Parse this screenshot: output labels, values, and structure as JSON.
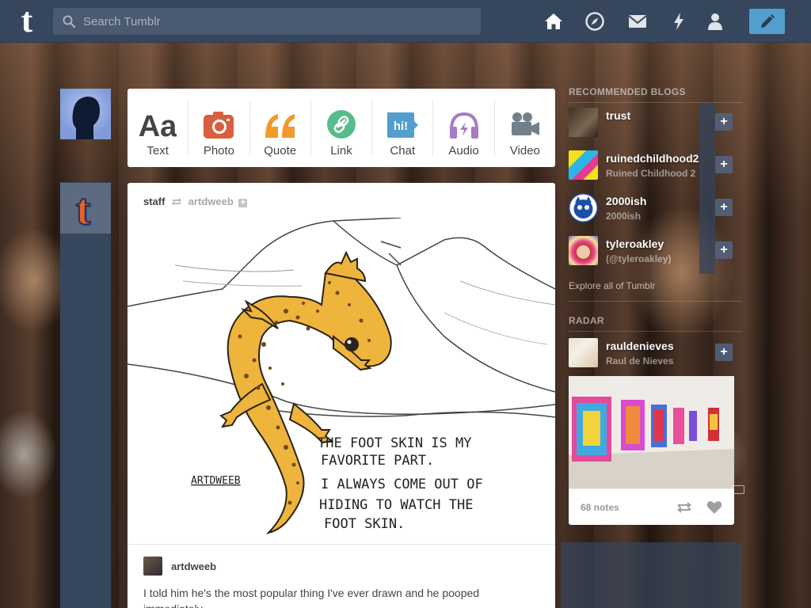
{
  "header": {
    "logo": "t",
    "search_placeholder": "Search Tumblr",
    "nav": [
      "home-icon",
      "explore-icon",
      "inbox-icon",
      "activity-icon",
      "account-icon"
    ],
    "compose_icon": "pencil-icon"
  },
  "post_types": [
    {
      "label": "Text",
      "icon": "text-icon",
      "color": "#444444"
    },
    {
      "label": "Photo",
      "icon": "camera-icon",
      "color": "#d95e40"
    },
    {
      "label": "Quote",
      "icon": "quote-icon",
      "color": "#f2992e"
    },
    {
      "label": "Link",
      "icon": "link-icon",
      "color": "#56bc8a"
    },
    {
      "label": "Chat",
      "icon": "chat-icon",
      "color": "#529ecc"
    },
    {
      "label": "Audio",
      "icon": "headphones-icon",
      "color": "#a77dc2"
    },
    {
      "label": "Video",
      "icon": "video-camera-icon",
      "color": "#748089"
    }
  ],
  "post": {
    "author": "staff",
    "reblogged_from": "artdweeb",
    "art_text": {
      "signature": "ARTDWEEB",
      "line1": "THE FOOT SKIN IS MY",
      "line2": "FAVORITE PART.",
      "line3": "I ALWAYS COME OUT OF",
      "line4": "HIDING TO WATCH THE",
      "line5": "FOOT SKIN."
    },
    "reblogger": "artdweeb",
    "body": "I told him he's the most popular thing I've ever drawn and he pooped immediately."
  },
  "sidebar": {
    "recommended_title": "RECOMMENDED BLOGS",
    "blogs": [
      {
        "name": "trust",
        "subtitle": ""
      },
      {
        "name": "ruinedchildhood2",
        "subtitle": "Ruined Childhood 2"
      },
      {
        "name": "2000ish",
        "subtitle": "2000ish"
      },
      {
        "name": "tyleroakley",
        "subtitle": "(@tyleroakley)"
      }
    ],
    "explore_link": "Explore all of Tumblr",
    "radar_title": "RADAR",
    "radar": {
      "name": "rauldenieves",
      "subtitle": "Raul de Nieves",
      "notes": "68 notes"
    }
  },
  "colors": {
    "header": "#36465d",
    "compose": "#529ecc",
    "search": "#4a5a70"
  }
}
